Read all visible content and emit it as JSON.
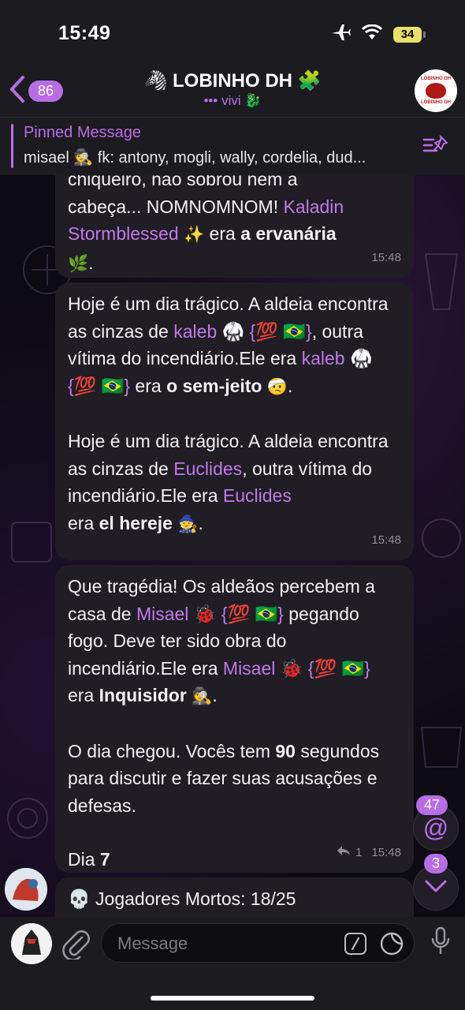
{
  "status_bar": {
    "time": "15:49",
    "battery": "34"
  },
  "header": {
    "back_count": "86",
    "title": "🦓 LOBINHO DH 🧩",
    "subtitle": "••• vivi 🐉",
    "avatar_text_top": "LOBINHO DH",
    "avatar_text_bottom": "LOBINHO DH"
  },
  "pinned": {
    "label": "Pinned Message",
    "text": "misael 🕵️ fk: antony, mogli, wally, cordelia, dud..."
  },
  "messages": [
    {
      "partial_top": "chiqueiro, não sobrou nem a",
      "line2_pre": "cabeça... NOMNOMNOM! ",
      "name": "Kaladin Stormblessed",
      "emoji_after_name": "✨",
      "mid": " era ",
      "role": "a ervanária",
      "emoji_end": "🌿",
      "end": ".",
      "time": "15:48"
    },
    {
      "p1_pre": "Hoje é um dia trágico. A aldeia encontra as cinzas de ",
      "p1_name": "kaleb 🥋 {💯 🇧🇷}",
      "p1_mid": ", outra vítima do incendiário.Ele era ",
      "p1_name2": "kaleb 🥋 {💯 🇧🇷}",
      "p1_mid2": " era ",
      "p1_role": "o sem-jeito",
      "p1_emoji": "🤕",
      "p1_end": ".",
      "p2_pre": "Hoje é um dia trágico. A aldeia encontra as cinzas de ",
      "p2_name": "Euclides",
      "p2_mid": ", outra vítima do incendiário.Ele era ",
      "p2_name2": "Euclides",
      "p2_mid2": " era ",
      "p2_role": "el hereje",
      "p2_emoji": "🧙",
      "p2_end": ".",
      "time": "15:48"
    },
    {
      "p1_pre": "Que tragédia! Os aldeãos percebem a casa de ",
      "p1_name": "Misael 🐞 {💯 🇧🇷}",
      "p1_mid": " pegando fogo. Deve ter sido obra do incendiário.Ele era ",
      "p1_name2": "Misael 🐞 {💯 🇧🇷}",
      "p1_mid2": " era ",
      "p1_role": "Inquisidor",
      "p1_emoji": "🕵️",
      "p1_end": ".",
      "p2_pre": "O dia chegou. Vocês tem ",
      "p2_num": "90",
      "p2_end": " segundos para discutir e fazer suas acusações e defesas.",
      "p3_pre": "Dia ",
      "p3_num": "7",
      "reply_count": "1",
      "time": "15:48"
    },
    {
      "text": "💀 Jogadores Mortos: 18/25"
    }
  ],
  "floating": {
    "mentions_count": "47",
    "scroll_count": "3"
  },
  "input": {
    "placeholder": "Message"
  },
  "colors": {
    "accent": "#b86de6",
    "bubble": "#201d25",
    "bar": "#1c1b20"
  }
}
